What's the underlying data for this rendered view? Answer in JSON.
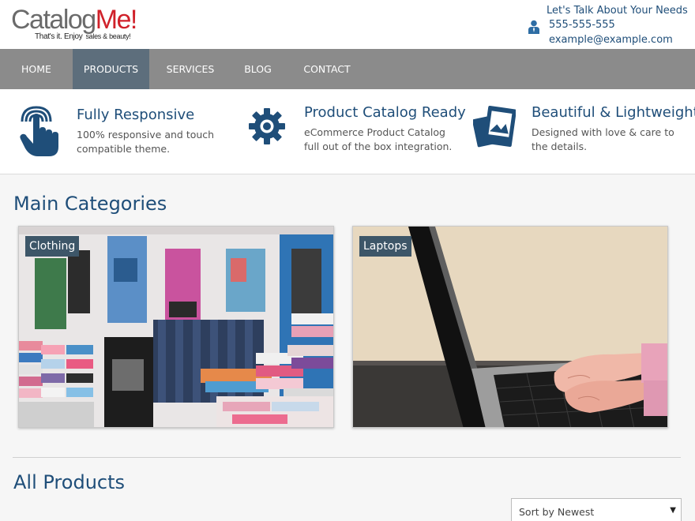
{
  "logo": {
    "brand_main": "Catalog",
    "brand_accent": "Me!",
    "tagline": "That's it. Enjoy",
    "tagline_sub": "sales & beauty!"
  },
  "contact": {
    "title": "Let's Talk About Your Needs",
    "phone": "555-555-555",
    "email": "example@example.com",
    "icon": "user-icon"
  },
  "nav": {
    "items": [
      {
        "label": "Home",
        "active": false
      },
      {
        "label": "Products",
        "active": true
      },
      {
        "label": "Services",
        "active": false
      },
      {
        "label": "Blog",
        "active": false
      },
      {
        "label": "Contact",
        "active": false
      }
    ]
  },
  "features": [
    {
      "icon": "touch-hand-icon",
      "title": "Fully Responsive",
      "text": "100% responsive and touch compatible theme."
    },
    {
      "icon": "gear-icon",
      "title": "Product Catalog Ready",
      "text": "eCommerce Product Catalog full out of the box integration."
    },
    {
      "icon": "photos-icon",
      "title": "Beautiful & Lightweight",
      "text": "Designed with love & care to the details."
    }
  ],
  "main": {
    "categories_title": "Main Categories",
    "categories": [
      {
        "label": "Clothing"
      },
      {
        "label": "Laptops"
      }
    ],
    "products_title": "All Products",
    "sort": {
      "selected": "Sort by Newest"
    }
  },
  "colors": {
    "accent": "#1f4e79",
    "brand_red": "#d0212a",
    "nav_bg": "#8b8b8b",
    "nav_active": "#5d6e7c",
    "label_bg": "#3d5668"
  }
}
